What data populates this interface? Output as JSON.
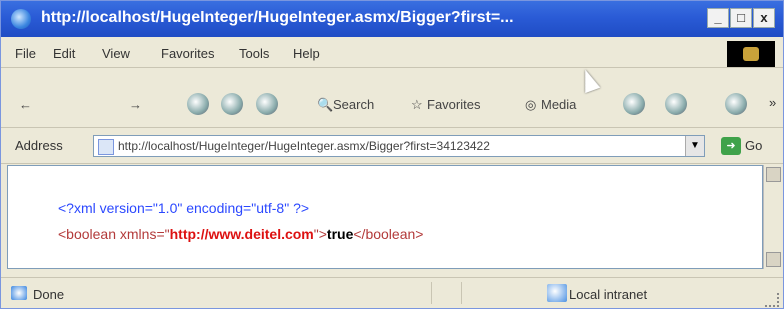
{
  "window": {
    "title": "http://localhost/HugeInteger/HugeInteger.asmx/Bigger?first=...",
    "controls": {
      "minimize": "_",
      "maximize": "□",
      "close": "x"
    }
  },
  "menubar": {
    "items": [
      "File",
      "Edit",
      "View",
      "Favorites",
      "Tools",
      "Help"
    ]
  },
  "toolbar": {
    "back_label": "←",
    "forward_label": "→",
    "search_label": "Search",
    "favorites_label": "Favorites",
    "media_label": "Media",
    "more_label": "»"
  },
  "address": {
    "label": "Address",
    "url": "http://localhost/HugeInteger/HugeInteger.asmx/Bigger?first=34123422",
    "go_label": "Go"
  },
  "content": {
    "line1": "<?xml version=\"1.0\" encoding=\"utf-8\" ?>",
    "line2_open": "<boolean xmlns=\"",
    "line2_url": "http://www.deitel.com",
    "line2_mid": "\">",
    "line2_value": "true",
    "line2_close": "</boolean>"
  },
  "status": {
    "text": "Done",
    "zone": "Local intranet"
  },
  "colors": {
    "title_gradient": "#2a5bd6",
    "xml_decl": "#2b48ff",
    "xml_tag": "#b33a3a",
    "xml_url": "#dd1111"
  },
  "icons": [
    "ie-icon",
    "stop-icon",
    "refresh-icon",
    "home-icon",
    "search-icon",
    "favorites-icon",
    "media-icon",
    "history-icon",
    "mail-icon",
    "print-icon",
    "page-icon",
    "go-icon",
    "intranet-icon",
    "windows-logo-icon",
    "cursor-icon"
  ]
}
